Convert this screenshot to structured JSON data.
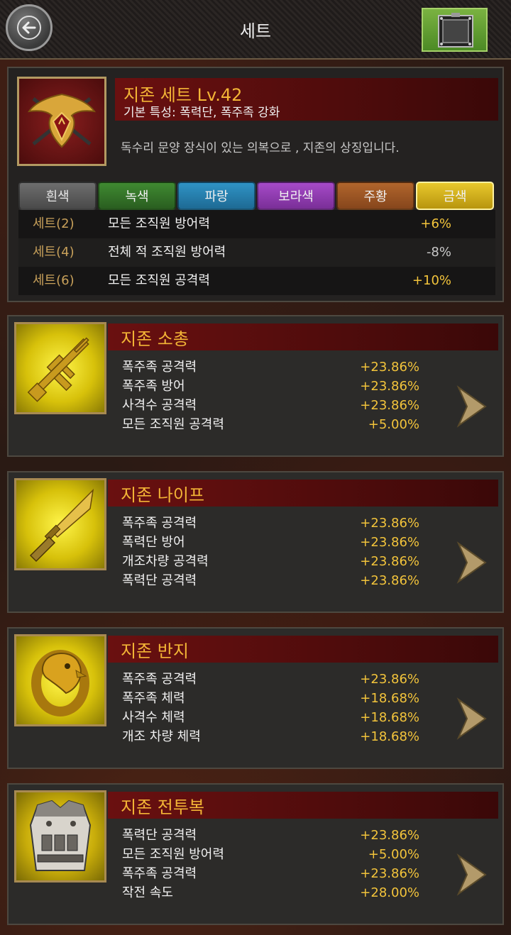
{
  "header": {
    "title": "세트"
  },
  "set": {
    "name": "지존 세트 Lv.42",
    "base_trait": "기본 특성: 폭력단, 폭주족 강화",
    "description": "독수리 문양 장식이 있는 의복으로 , 지존의 상징입니다.",
    "tabs": [
      "흰색",
      "녹색",
      "파랑",
      "보라색",
      "주황",
      "금색"
    ],
    "selected_tab": "금색",
    "bonuses": [
      {
        "label": "세트(2)",
        "stat": "모든 조직원 방어력",
        "value": "+6%"
      },
      {
        "label": "세트(4)",
        "stat": "전체 적 조직원 방어력",
        "value": "-8%"
      },
      {
        "label": "세트(6)",
        "stat": "모든 조직원 공격력",
        "value": "+10%"
      }
    ]
  },
  "items": [
    {
      "name": "지존 소총",
      "icon": "gold-rifle-icon",
      "stats": [
        {
          "name": "폭주족 공격력",
          "value": "+23.86%"
        },
        {
          "name": "폭주족 방어",
          "value": "+23.86%"
        },
        {
          "name": "사격수 공격력",
          "value": "+23.86%"
        },
        {
          "name": "모든 조직원 공격력",
          "value": "+5.00%"
        }
      ]
    },
    {
      "name": "지존 나이프",
      "icon": "gold-knife-icon",
      "stats": [
        {
          "name": "폭주족 공격력",
          "value": "+23.86%"
        },
        {
          "name": "폭력단 방어",
          "value": "+23.86%"
        },
        {
          "name": "개조차량 공격력",
          "value": "+23.86%"
        },
        {
          "name": "폭력단 공격력",
          "value": "+23.86%"
        }
      ]
    },
    {
      "name": "지존 반지",
      "icon": "gold-eagle-ring-icon",
      "stats": [
        {
          "name": "폭주족 공격력",
          "value": "+23.86%"
        },
        {
          "name": "폭주족 체력",
          "value": "+18.68%"
        },
        {
          "name": "사격수 체력",
          "value": "+18.68%"
        },
        {
          "name": "개조 차량 체력",
          "value": "+18.68%"
        }
      ]
    },
    {
      "name": "지존 전투복",
      "icon": "combat-vest-icon",
      "stats": [
        {
          "name": "폭력단 공격력",
          "value": "+23.86%"
        },
        {
          "name": "모든 조직원 방어력",
          "value": "+5.00%"
        },
        {
          "name": "폭주족 공격력",
          "value": "+23.86%"
        },
        {
          "name": "작전 속도",
          "value": "+28.00%"
        }
      ]
    }
  ],
  "colors": {
    "gold_text": "#f3b536",
    "value_text": "#f3c43b",
    "title_bar": "#6a1010"
  }
}
